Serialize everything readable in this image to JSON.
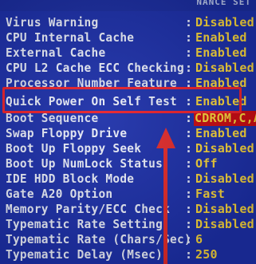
{
  "header": {
    "title": "NANCE SET"
  },
  "settings": [
    {
      "label": "Virus Warning",
      "value": "Disabled"
    },
    {
      "label": "CPU Internal Cache",
      "value": "Enabled"
    },
    {
      "label": "External Cache",
      "value": "Enabled"
    },
    {
      "label": "CPU L2 Cache ECC Checking",
      "value": "Disabled"
    },
    {
      "label": "Processor Number Feature",
      "value": "Enabled"
    },
    {
      "label": "Quick Power On Self Test",
      "value": "Enabled"
    },
    {
      "label": "Boot Sequence",
      "value": "CDROM,C,A"
    },
    {
      "label": "Swap Floppy Drive",
      "value": "Enabled"
    },
    {
      "label": "Boot Up Floppy Seek",
      "value": "Disabled"
    },
    {
      "label": "Boot Up NumLock Status",
      "value": "Off"
    },
    {
      "label": "IDE HDD Block Mode",
      "value": "Disabled"
    },
    {
      "label": "Gate A20 Option",
      "value": "Fast"
    },
    {
      "label": "Memory Parity/ECC Check",
      "value": "Disabled"
    },
    {
      "label": "Typematic Rate Setting",
      "value": "Disabled"
    },
    {
      "label": "Typematic Rate (Chars/Sec)",
      "value": "6"
    },
    {
      "label": "Typematic Delay (Msec)",
      "value": "250"
    }
  ],
  "separator": ":",
  "colors": {
    "background": "#1c2fa8",
    "label_text": "#e8ecf8",
    "value_text": "#f5d23a",
    "selected_background": "#c80a12",
    "annotation_red": "#e8202a"
  }
}
